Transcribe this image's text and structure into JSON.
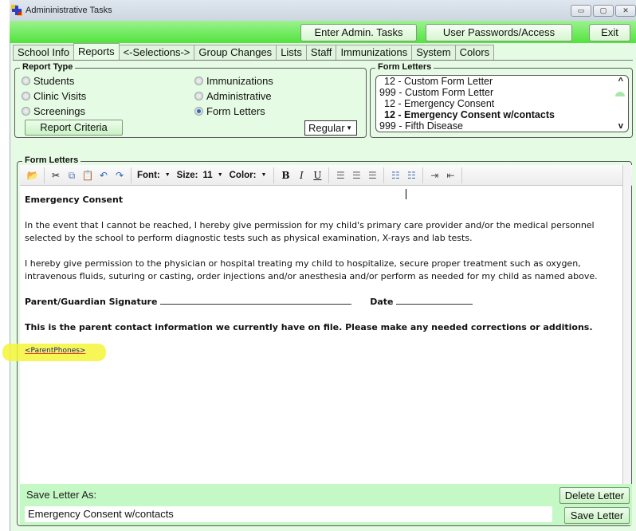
{
  "window": {
    "title": "Admininistrative Tasks",
    "controls": {
      "minimize": "▭",
      "maximize": "▢",
      "close": "✕"
    }
  },
  "top_buttons": {
    "enter_admin": "Enter Admin. Tasks",
    "user_passwords": "User Passwords/Access",
    "exit": "Exit"
  },
  "tabs": [
    {
      "label": "School Info",
      "active": false
    },
    {
      "label": "Reports",
      "active": true
    },
    {
      "label": "<-Selections->",
      "active": false
    },
    {
      "label": "Group Changes",
      "active": false
    },
    {
      "label": "Lists",
      "active": false
    },
    {
      "label": "Staff",
      "active": false
    },
    {
      "label": "Immunizations",
      "active": false
    },
    {
      "label": "System",
      "active": false
    },
    {
      "label": "Colors",
      "active": false
    }
  ],
  "report_type": {
    "legend": "Report Type",
    "options": [
      {
        "label": "Students",
        "checked": false
      },
      {
        "label": "Clinic Visits",
        "checked": false
      },
      {
        "label": "Screenings",
        "checked": false
      },
      {
        "label": "Immunizations",
        "checked": false
      },
      {
        "label": "Administrative",
        "checked": false
      },
      {
        "label": "Form Letters",
        "checked": true
      }
    ],
    "report_criteria_button": "Report Criteria",
    "mode_select": "Regular"
  },
  "form_letters_list": {
    "legend": "Form Letters",
    "items": [
      {
        "label": "12 - Custom Form Letter",
        "selected": false
      },
      {
        "label": "999 - Custom Form Letter",
        "selected": false
      },
      {
        "label": "12 - Emergency Consent",
        "selected": false
      },
      {
        "label": "12 - Emergency Consent w/contacts",
        "selected": true
      },
      {
        "label": "999 - Fifth Disease",
        "selected": false
      }
    ],
    "scroll_up": "^",
    "scroll_down": "v"
  },
  "editor": {
    "legend": "Form Letters",
    "toolbar": {
      "font_label": "Font:",
      "size_label": "Size:",
      "size_value": "11",
      "color_label": "Color:",
      "bold": "B",
      "italic": "I",
      "underline": "U"
    },
    "content": {
      "heading": "Emergency Consent",
      "para1": "In the event that I cannot be reached, I hereby give permission for my child's primary care provider and/or the medical personnel selected by the school to perform diagnostic tests such as physical examination, X-rays and lab tests.",
      "para2": "I hereby give permission to the physician or hospital treating my child to hospitalize, secure proper treatment such as oxygen, intravenous fluids, suturing or casting, order injections and/or anesthesia and/or perform as needed for my child as named above.",
      "signature_label": "Parent/Guardian Signature",
      "date_label": "Date",
      "contact_info": "This is the parent contact information we currently have on file.  Please make any needed corrections or additions.",
      "placeholder_field": "<ParentPhones>"
    }
  },
  "save_section": {
    "label": "Save Letter As:",
    "value": "Emergency Consent w/contacts",
    "delete_button": "Delete Letter",
    "save_button": "Save Letter"
  }
}
